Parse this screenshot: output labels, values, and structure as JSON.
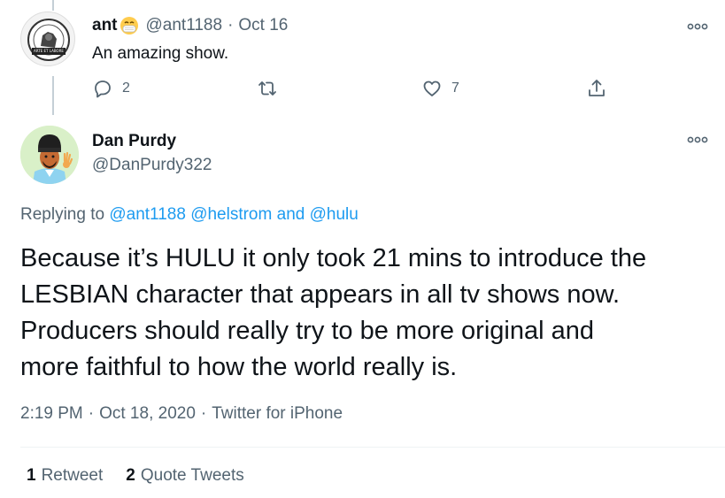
{
  "parent_tweet": {
    "name": "ant",
    "handle": "@ant1188",
    "separator": "·",
    "date": "Oct 16",
    "text": "An amazing show.",
    "avatar_caption": "ARTE ET LABORE",
    "reply_count": "2",
    "retweet_count": "",
    "like_count": "7"
  },
  "main_tweet": {
    "name": "Dan Purdy",
    "handle": "@DanPurdy322",
    "replying_prefix": "Replying to",
    "replying_1": "@ant1188",
    "replying_2": "@helstrom",
    "replying_and": "and",
    "replying_3": "@hulu",
    "text_lines": [
      "Because it’s HULU it only took 21 mins to introduce the",
      "LESBIAN character that appears in all tv shows now.",
      "Producers should really try to be more original and",
      "more faithful to how the world really is."
    ],
    "time": "2:19 PM",
    "separator": "·",
    "date": "Oct 18, 2020",
    "source": "Twitter for iPhone"
  },
  "stats": {
    "retweets_count": "1",
    "retweets_label": "Retweet",
    "quotes_count": "2",
    "quotes_label": "Quote Tweets"
  },
  "icons": {
    "reply": "reply-icon",
    "retweet": "retweet-icon",
    "like": "heart-icon",
    "share": "share-icon",
    "more": "more-icon"
  },
  "colors": {
    "accent": "#1d9bf0",
    "text_primary": "#0f1419",
    "text_secondary": "#536471",
    "thread_line": "#c4cfd6"
  }
}
